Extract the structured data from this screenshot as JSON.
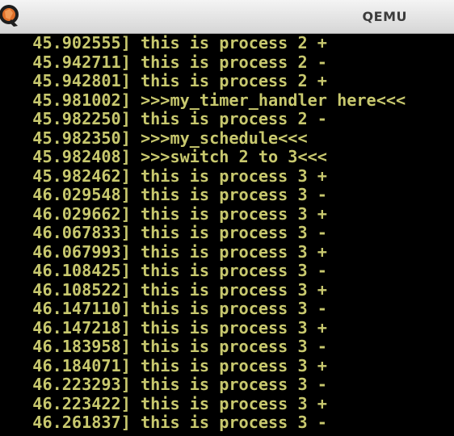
{
  "window": {
    "title": "QEMU",
    "icon": "qemu-logo-icon"
  },
  "console": {
    "lines": [
      "  45.902555] this is process 2 +",
      "  45.942711] this is process 2 -",
      "  45.942801] this is process 2 +",
      "  45.981002] >>>my_timer_handler here<<<",
      "  45.982250] this is process 2 -",
      "  45.982350] >>>my_schedule<<<",
      "  45.982408] >>>switch 2 to 3<<<",
      "  45.982462] this is process 3 +",
      "  46.029548] this is process 3 -",
      "  46.029662] this is process 3 +",
      "  46.067833] this is process 3 -",
      "  46.067993] this is process 3 +",
      "  46.108425] this is process 3 -",
      "  46.108522] this is process 3 +",
      "  46.147110] this is process 3 -",
      "  46.147218] this is process 3 +",
      "  46.183958] this is process 3 -",
      "  46.184071] this is process 3 +",
      "  46.223293] this is process 3 -",
      "  46.223422] this is process 3 +",
      "  46.261837] this is process 3 -"
    ],
    "text_color": "#c8c86e",
    "background": "#000000"
  }
}
